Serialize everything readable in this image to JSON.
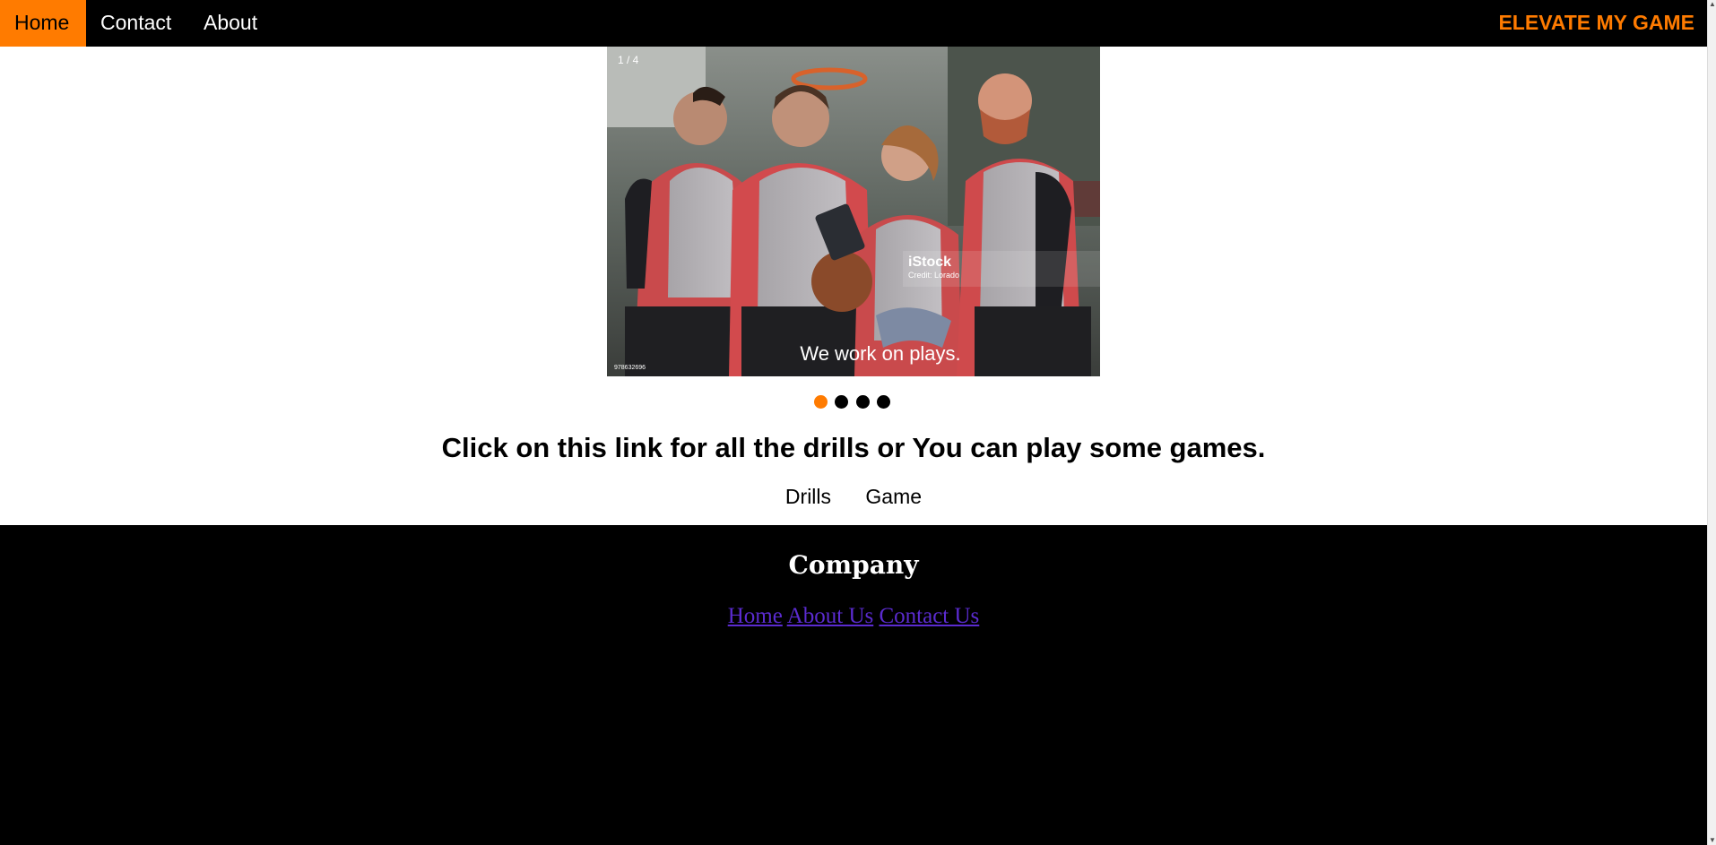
{
  "nav": {
    "items": [
      {
        "label": "Home",
        "active": true
      },
      {
        "label": "Contact",
        "active": false
      },
      {
        "label": "About",
        "active": false
      }
    ],
    "brand": "ELEVATE MY GAME",
    "accent_color": "#ff7b00"
  },
  "slideshow": {
    "counter": "1 / 4",
    "caption": "We work on plays.",
    "watermark": {
      "name": "iStock",
      "credit": "Credit: Lorado",
      "id": "978632696"
    },
    "slide_count": 4,
    "active_index": 0
  },
  "main": {
    "headline": "Click on this link for all the drills or You can play some games.",
    "links": [
      "Drills",
      "Game"
    ]
  },
  "footer": {
    "title": "Company",
    "links": [
      "Home",
      "About Us",
      "Contact Us"
    ],
    "link_color": "#5b2bd0"
  }
}
